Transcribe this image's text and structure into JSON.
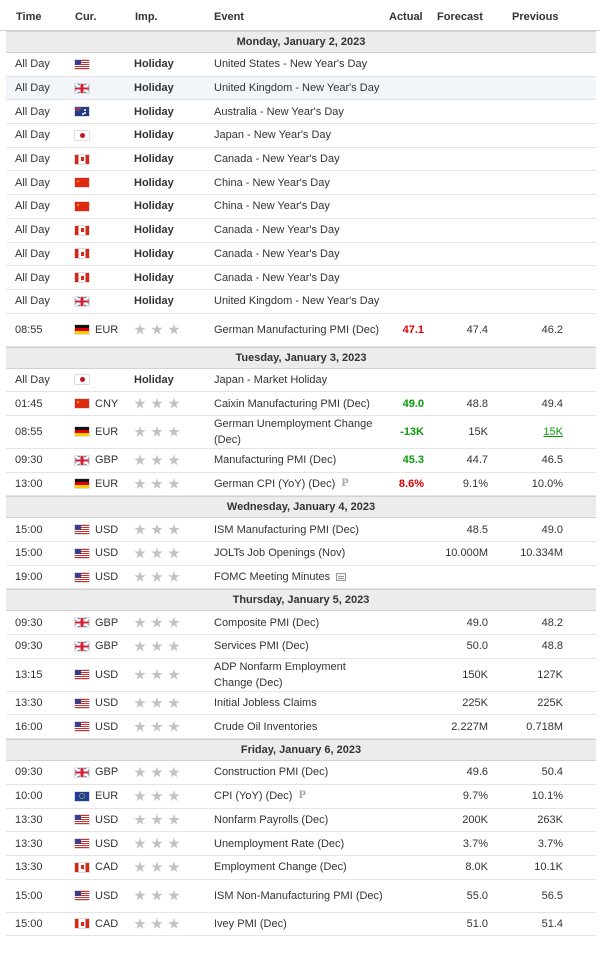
{
  "header": {
    "time": "Time",
    "cur": "Cur.",
    "imp": "Imp.",
    "event": "Event",
    "actual": "Actual",
    "forecast": "Forecast",
    "previous": "Previous"
  },
  "days": [
    {
      "date": "Monday, January 2, 2023",
      "events": [
        {
          "time": "All Day",
          "flag": "us",
          "holiday": "Holiday",
          "event": "United States - New Year's Day"
        },
        {
          "time": "All Day",
          "flag": "gb",
          "holiday": "Holiday",
          "event": "United Kingdom - New Year's Day",
          "alt": true
        },
        {
          "time": "All Day",
          "flag": "au",
          "holiday": "Holiday",
          "event": "Australia - New Year's Day"
        },
        {
          "time": "All Day",
          "flag": "jp",
          "holiday": "Holiday",
          "event": "Japan - New Year's Day"
        },
        {
          "time": "All Day",
          "flag": "ca",
          "holiday": "Holiday",
          "event": "Canada - New Year's Day"
        },
        {
          "time": "All Day",
          "flag": "cn",
          "holiday": "Holiday",
          "event": "China - New Year's Day"
        },
        {
          "time": "All Day",
          "flag": "cn",
          "holiday": "Holiday",
          "event": "China - New Year's Day"
        },
        {
          "time": "All Day",
          "flag": "ca",
          "holiday": "Holiday",
          "event": "Canada - New Year's Day"
        },
        {
          "time": "All Day",
          "flag": "ca",
          "holiday": "Holiday",
          "event": "Canada - New Year's Day"
        },
        {
          "time": "All Day",
          "flag": "ca",
          "holiday": "Holiday",
          "event": "Canada - New Year's Day"
        },
        {
          "time": "All Day",
          "flag": "gb",
          "holiday": "Holiday",
          "event": "United Kingdom - New Year's Day"
        },
        {
          "time": "08:55",
          "flag": "de",
          "cur": "EUR",
          "event": "German Manufacturing PMI (Dec)",
          "actual": "47.1",
          "actual_color": "red",
          "forecast": "47.4",
          "previous": "46.2",
          "tall": true
        }
      ]
    },
    {
      "date": "Tuesday, January 3, 2023",
      "events": [
        {
          "time": "All Day",
          "flag": "jp",
          "holiday": "Holiday",
          "event": "Japan - Market Holiday"
        },
        {
          "time": "01:45",
          "flag": "cn",
          "cur": "CNY",
          "event": "Caixin Manufacturing PMI (Dec)",
          "actual": "49.0",
          "actual_color": "green",
          "forecast": "48.8",
          "previous": "49.4"
        },
        {
          "time": "08:55",
          "flag": "de",
          "cur": "EUR",
          "event": "German Unemployment Change (Dec)",
          "actual": "-13K",
          "actual_color": "green",
          "forecast": "15K",
          "previous": "15K",
          "previous_style": "green-ul",
          "tall": true
        },
        {
          "time": "09:30",
          "flag": "gb",
          "cur": "GBP",
          "event": "Manufacturing PMI (Dec)",
          "actual": "45.3",
          "actual_color": "green",
          "forecast": "44.7",
          "previous": "46.5"
        },
        {
          "time": "13:00",
          "flag": "de",
          "cur": "EUR",
          "event": "German CPI (YoY) (Dec)",
          "icon": "p",
          "actual": "8.6%",
          "actual_color": "red",
          "forecast": "9.1%",
          "previous": "10.0%"
        }
      ]
    },
    {
      "date": "Wednesday, January 4, 2023",
      "events": [
        {
          "time": "15:00",
          "flag": "us",
          "cur": "USD",
          "event": "ISM Manufacturing PMI (Dec)",
          "forecast": "48.5",
          "previous": "49.0"
        },
        {
          "time": "15:00",
          "flag": "us",
          "cur": "USD",
          "event": "JOLTs Job Openings (Nov)",
          "forecast": "10.000M",
          "previous": "10.334M"
        },
        {
          "time": "19:00",
          "flag": "us",
          "cur": "USD",
          "event": "FOMC Meeting Minutes",
          "icon": "doc"
        }
      ]
    },
    {
      "date": "Thursday, January 5, 2023",
      "events": [
        {
          "time": "09:30",
          "flag": "gb",
          "cur": "GBP",
          "event": "Composite PMI (Dec)",
          "forecast": "49.0",
          "previous": "48.2"
        },
        {
          "time": "09:30",
          "flag": "gb",
          "cur": "GBP",
          "event": "Services PMI (Dec)",
          "forecast": "50.0",
          "previous": "48.8"
        },
        {
          "time": "13:15",
          "flag": "us",
          "cur": "USD",
          "event": "ADP Nonfarm Employment Change (Dec)",
          "forecast": "150K",
          "previous": "127K",
          "tall": true
        },
        {
          "time": "13:30",
          "flag": "us",
          "cur": "USD",
          "event": "Initial Jobless Claims",
          "forecast": "225K",
          "previous": "225K"
        },
        {
          "time": "16:00",
          "flag": "us",
          "cur": "USD",
          "event": "Crude Oil Inventories",
          "forecast": "2.227M",
          "previous": "0.718M"
        }
      ]
    },
    {
      "date": "Friday, January 6, 2023",
      "events": [
        {
          "time": "09:30",
          "flag": "gb",
          "cur": "GBP",
          "event": "Construction PMI (Dec)",
          "forecast": "49.6",
          "previous": "50.4"
        },
        {
          "time": "10:00",
          "flag": "eu",
          "cur": "EUR",
          "event": "CPI (YoY) (Dec)",
          "icon": "p",
          "forecast": "9.7%",
          "previous": "10.1%"
        },
        {
          "time": "13:30",
          "flag": "us",
          "cur": "USD",
          "event": "Nonfarm Payrolls (Dec)",
          "forecast": "200K",
          "previous": "263K"
        },
        {
          "time": "13:30",
          "flag": "us",
          "cur": "USD",
          "event": "Unemployment Rate (Dec)",
          "forecast": "3.7%",
          "previous": "3.7%"
        },
        {
          "time": "13:30",
          "flag": "ca",
          "cur": "CAD",
          "event": "Employment Change (Dec)",
          "forecast": "8.0K",
          "previous": "10.1K"
        },
        {
          "time": "15:00",
          "flag": "us",
          "cur": "USD",
          "event": "ISM Non-Manufacturing PMI (Dec)",
          "forecast": "55.0",
          "previous": "56.5",
          "tall": true
        },
        {
          "time": "15:00",
          "flag": "ca",
          "cur": "CAD",
          "event": "Ivey PMI (Dec)",
          "forecast": "51.0",
          "previous": "51.4"
        }
      ]
    }
  ]
}
